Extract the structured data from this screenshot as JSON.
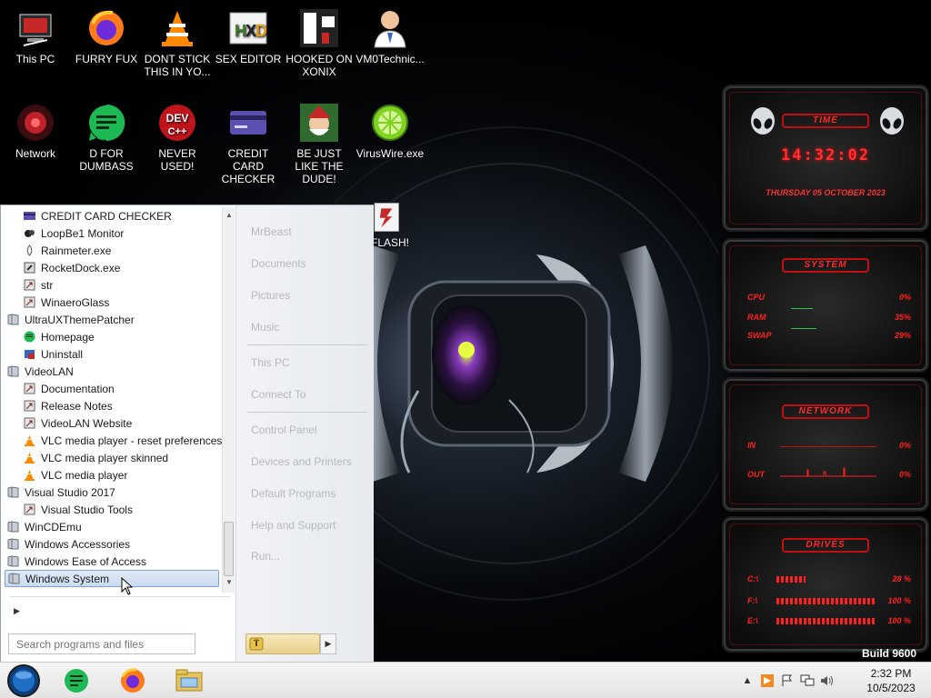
{
  "desktop_icons": [
    {
      "label": "This PC",
      "icon": "computer-icon"
    },
    {
      "label": "FURRY FUX",
      "icon": "firefox-icon"
    },
    {
      "label": "DONT STICK THIS IN YO...",
      "icon": "vlc-cone-icon"
    },
    {
      "label": "SEX EDITOR",
      "icon": "hxd-editor-icon"
    },
    {
      "label": "HOOKED ON XONIX",
      "icon": "xonix-game-icon"
    },
    {
      "label": "VM0Technic...",
      "icon": "doctor-person-icon"
    },
    {
      "label": "Network",
      "icon": "network-icon"
    },
    {
      "label": "D FOR DUMBASS",
      "icon": "notepad-green-icon"
    },
    {
      "label": "NEVER USED!",
      "icon": "devcpp-icon"
    },
    {
      "label": "CREDIT CARD CHECKER",
      "icon": "credit-card-icon"
    },
    {
      "label": "BE JUST LIKE THE DUDE!",
      "icon": "santa-dude-icon"
    },
    {
      "label": "VirusWire.exe",
      "icon": "lime-icon"
    },
    {
      "label": "FLASH!",
      "icon": "flash-icon"
    }
  ],
  "start_menu": {
    "programs": [
      {
        "label": "CREDIT CARD CHECKER",
        "level": 1,
        "icon": "credit-card-icon"
      },
      {
        "label": "LoopBe1 Monitor",
        "level": 1,
        "icon": "loopbe-icon"
      },
      {
        "label": "Rainmeter.exe",
        "level": 1,
        "icon": "rainmeter-icon"
      },
      {
        "label": "RocketDock.exe",
        "level": 1,
        "icon": "rocketdock-icon"
      },
      {
        "label": "str",
        "level": 1,
        "icon": "shortcut-icon"
      },
      {
        "label": "WinaeroGlass",
        "level": 1,
        "icon": "shortcut-icon"
      },
      {
        "label": "UltraUXThemePatcher",
        "level": 0,
        "icon": "folder-icon"
      },
      {
        "label": "Homepage",
        "level": 1,
        "icon": "notepad-green-icon"
      },
      {
        "label": "Uninstall",
        "level": 1,
        "icon": "uninstall-icon"
      },
      {
        "label": "VideoLAN",
        "level": 0,
        "icon": "folder-icon"
      },
      {
        "label": "Documentation",
        "level": 1,
        "icon": "shortcut-icon"
      },
      {
        "label": "Release Notes",
        "level": 1,
        "icon": "shortcut-icon"
      },
      {
        "label": "VideoLAN Website",
        "level": 1,
        "icon": "shortcut-icon"
      },
      {
        "label": "VLC media player - reset preferences ar",
        "level": 1,
        "icon": "vlc-cone-icon"
      },
      {
        "label": "VLC media player skinned",
        "level": 1,
        "icon": "vlc-cone-icon"
      },
      {
        "label": "VLC media player",
        "level": 1,
        "icon": "vlc-cone-icon"
      },
      {
        "label": "Visual Studio 2017",
        "level": 0,
        "icon": "folder-icon"
      },
      {
        "label": "Visual Studio Tools",
        "level": 1,
        "icon": "shortcut-icon"
      },
      {
        "label": "WinCDEmu",
        "level": 0,
        "icon": "folder-icon"
      },
      {
        "label": "Windows Accessories",
        "level": 0,
        "icon": "folder-icon"
      },
      {
        "label": "Windows Ease of Access",
        "level": 0,
        "icon": "folder-icon"
      },
      {
        "label": "Windows System",
        "level": 0,
        "icon": "folder-icon",
        "selected": true
      }
    ],
    "search_placeholder": "Search programs and files",
    "right_items": [
      {
        "label": "MrBeast"
      },
      {
        "label": "Documents"
      },
      {
        "label": "Pictures"
      },
      {
        "label": "Music"
      },
      {
        "label": "This PC"
      },
      {
        "label": "Connect To"
      },
      {
        "label": "Control Panel"
      },
      {
        "label": "Devices and Printers"
      },
      {
        "label": "Default Programs"
      },
      {
        "label": "Help and Support"
      },
      {
        "label": "Run..."
      }
    ]
  },
  "gadgets": {
    "time": {
      "title": "TIME",
      "clock": "14:32:02",
      "date": "THURSDAY 05 OCTOBER 2023"
    },
    "system": {
      "title": "SYSTEM",
      "rows": [
        {
          "label": "CPU",
          "value": "0%"
        },
        {
          "label": "RAM",
          "value": "35%"
        },
        {
          "label": "SWAP",
          "value": "29%"
        }
      ]
    },
    "network": {
      "title": "NETWORK",
      "rows": [
        {
          "label": "IN",
          "value": "0%"
        },
        {
          "label": "OUT",
          "value": "0%"
        }
      ]
    },
    "drives": {
      "title": "DRIVES",
      "rows": [
        {
          "label": "C:\\",
          "value": "28 %"
        },
        {
          "label": "F:\\",
          "value": "100 %"
        },
        {
          "label": "E:\\",
          "value": "100 %"
        }
      ]
    }
  },
  "build_text": "Build 9600",
  "taskbar": {
    "pinned": [
      "notepad-green-icon",
      "firefox-icon",
      "file-explorer-icon"
    ],
    "clock_time": "2:32 PM",
    "clock_date": "10/5/2023"
  },
  "colors": {
    "gadget_red": "#ff2a2a",
    "selection_blue": "#cbdcf0",
    "taskbar": "#ececec"
  }
}
